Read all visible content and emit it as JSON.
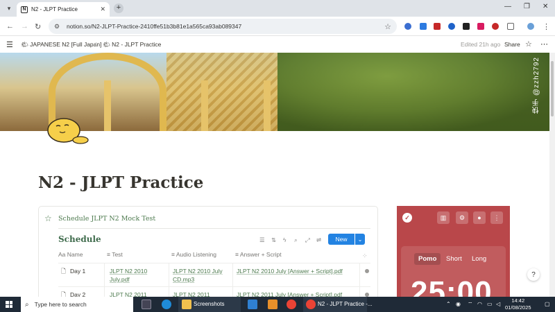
{
  "browser": {
    "tab_title": "N2 - JLPT Practice",
    "tab_favicon": "N",
    "tab_close": "✕",
    "new_tab": "+",
    "url": "notion.so/N2-JLPT-Practice-2410ffe51b3b81e1a565ca93ab089347"
  },
  "notion_header": {
    "workspace_crumb": "JAPANESE N2 [Full Japan]",
    "separator": "/",
    "page_crumb": "N2 - JLPT Practice",
    "edited": "Edited 21h ago",
    "share": "Share"
  },
  "cover": {
    "watermark": "快手 @zzh2792"
  },
  "page": {
    "title": "N2 - JLPT Practice"
  },
  "schedule_card": {
    "heading": "Schedule JLPT N2 Mock Test",
    "db_title": "Schedule",
    "new_button": "New",
    "columns": [
      "Name",
      "Test",
      "Audio Listening",
      "Answer + Script"
    ],
    "rows": [
      {
        "name": "Day 1",
        "test": "JLPT N2 2010 July.pdf",
        "audio": "JLPT N2 2010 July CD.mp3",
        "answer": "JLPT N2 2010 July [Answer + Script].pdf"
      },
      {
        "name": "Day 2",
        "test": "JLPT N2 2011",
        "audio": "JLPT N2 2011",
        "answer": "JLPT N2 2011 July [Answer + Script].pdf"
      }
    ]
  },
  "pomodoro": {
    "modes": [
      "Pomo",
      "Short",
      "Long"
    ],
    "active_mode": "Pomo",
    "time": "25:00",
    "accent": "#b9474a"
  },
  "taskbar": {
    "search_placeholder": "Type here to search",
    "screenshots_label": "Screenshots",
    "chrome_label": "N2 - JLPT Practice -...",
    "time": "14:42",
    "date": "01/08/2025"
  }
}
